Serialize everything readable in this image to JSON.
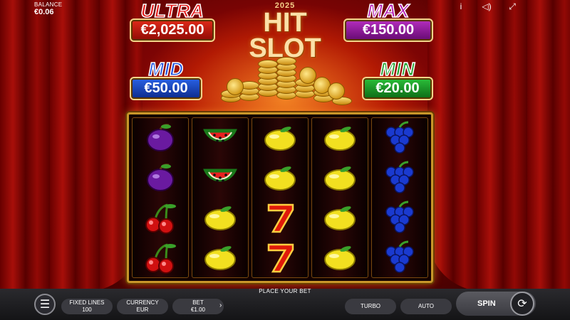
{
  "balance": {
    "label": "BALANCE",
    "value": "€0.06"
  },
  "top_icons": [
    "info-icon",
    "sound-icon",
    "fullscreen-icon"
  ],
  "jackpots": {
    "ultra": {
      "title": "ULTRA",
      "value": "€2,025.00"
    },
    "max": {
      "title": "MAX",
      "value": "€150.00"
    },
    "mid": {
      "title": "MID",
      "value": "€50.00"
    },
    "min": {
      "title": "MIN",
      "value": "€20.00"
    }
  },
  "logo": {
    "year": "2025",
    "name": "HIT SLOT"
  },
  "reels": [
    [
      "plum",
      "plum",
      "cherry",
      "cherry"
    ],
    [
      "watermelon",
      "watermelon",
      "lemon",
      "lemon"
    ],
    [
      "lemon",
      "lemon",
      "seven",
      "seven"
    ],
    [
      "lemon",
      "lemon",
      "lemon",
      "lemon"
    ],
    [
      "grapes",
      "grapes",
      "grapes",
      "grapes"
    ]
  ],
  "bottom": {
    "prompt": "PLACE YOUR BET",
    "fixed_lines": {
      "label": "FIXED LINES",
      "value": "100"
    },
    "currency": {
      "label": "CURRENCY",
      "value": "EUR"
    },
    "bet": {
      "label": "BET",
      "value": "€1.00"
    },
    "turbo": "TURBO",
    "auto": "AUTO",
    "spin": "SPIN"
  }
}
